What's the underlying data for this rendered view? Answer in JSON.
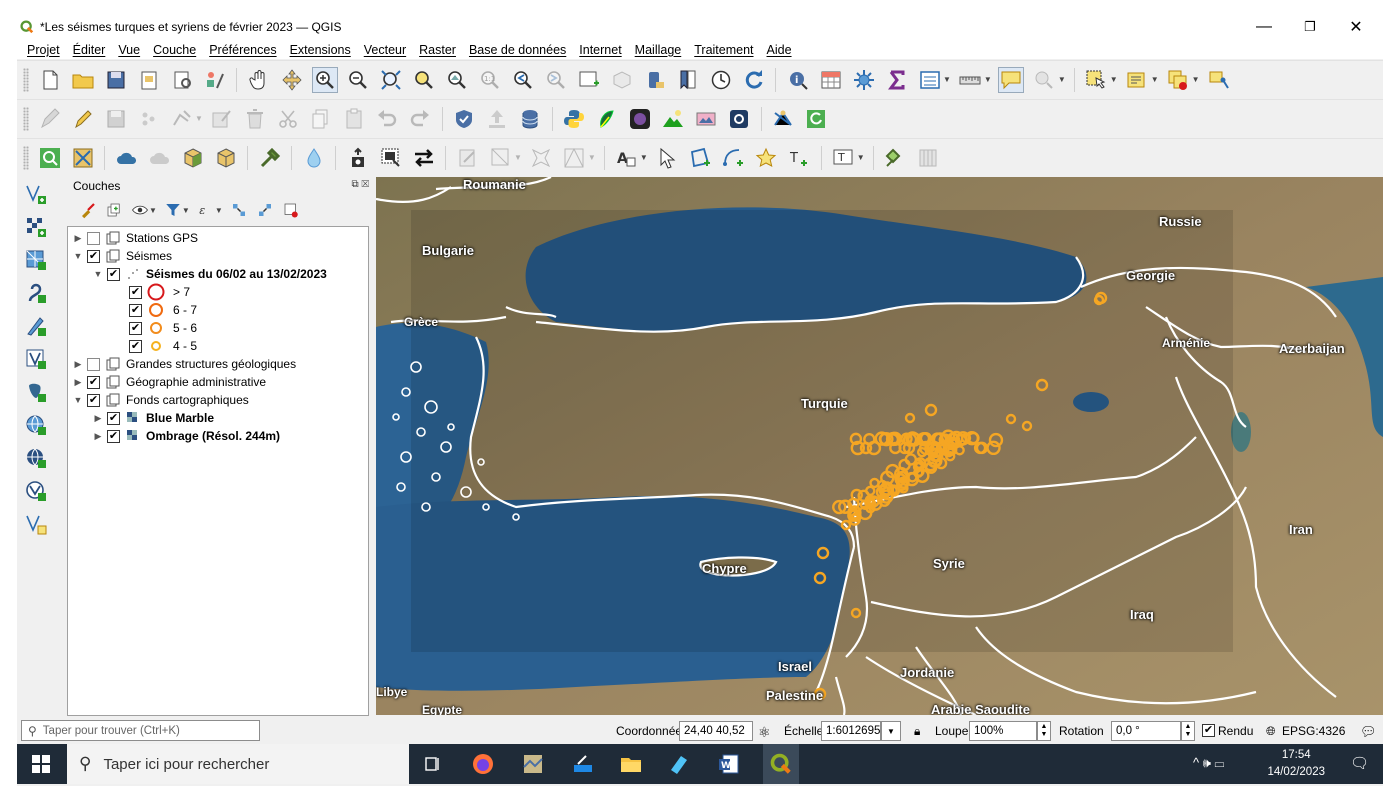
{
  "window": {
    "title": "*Les séismes turques et syriens de février 2023 — QGIS",
    "controls": {
      "minimize": "—",
      "restore": "❐",
      "close": "✕"
    }
  },
  "menu": [
    "Projet",
    "Éditer",
    "Vue",
    "Couche",
    "Préférences",
    "Extensions",
    "Vecteur",
    "Raster",
    "Base de données",
    "Internet",
    "Maillage",
    "Traitement",
    "Aide"
  ],
  "layers_panel": {
    "title": "Couches",
    "tree": [
      {
        "label": "Stations GPS",
        "checked": false,
        "expanded": false,
        "level": 0,
        "bold": false
      },
      {
        "label": "Séismes",
        "checked": true,
        "expanded": true,
        "level": 0,
        "bold": false
      },
      {
        "label": "Séismes du 06/02 au 13/02/2023",
        "checked": true,
        "expanded": true,
        "level": 1,
        "bold": true
      },
      {
        "label": "> 7",
        "checked": true,
        "level": 2,
        "legend_color": "#d7191c"
      },
      {
        "label": "6 - 7",
        "checked": true,
        "level": 2,
        "legend_color": "#f06a10"
      },
      {
        "label": "5 - 6",
        "checked": true,
        "level": 2,
        "legend_color": "#f28c1c"
      },
      {
        "label": "4 - 5",
        "checked": true,
        "level": 2,
        "legend_color": "#f5b21f"
      },
      {
        "label": "Grandes structures géologiques",
        "checked": false,
        "expanded": false,
        "level": 0,
        "bold": false
      },
      {
        "label": "Géographie administrative",
        "checked": true,
        "expanded": false,
        "level": 0,
        "bold": false
      },
      {
        "label": "Fonds cartographiques",
        "checked": true,
        "expanded": true,
        "level": 0,
        "bold": false
      },
      {
        "label": "Blue Marble",
        "checked": true,
        "expanded": false,
        "level": 1,
        "bold": true
      },
      {
        "label": "Ombrage (Résol. 244m)",
        "checked": true,
        "expanded": false,
        "level": 1,
        "bold": true
      }
    ]
  },
  "map": {
    "labels": [
      "Roumanie",
      "Russie",
      "Bulgarie",
      "Georgie",
      "Grèce",
      "Arménie",
      "Azerbaijan",
      "Turquie",
      "Iran",
      "Chypre",
      "Syrie",
      "Iraq",
      "Israel",
      "Jordanie",
      "Libye",
      "Palestine",
      "Egypte",
      "Arabie Saoudite"
    ],
    "colors": {
      "sea": "#2b5f8e",
      "land": "#8d7b55",
      "borders": "#ffffff",
      "quake": "#f5a623"
    }
  },
  "status": {
    "search_placeholder": "Taper pour trouver (Ctrl+K)",
    "coord_label": "Coordonnée",
    "coord_value": "24,40 40,52",
    "scale_label": "Échelle",
    "scale_value": "1:6012695",
    "magnifier_label": "Loupe",
    "magnifier_value": "100%",
    "rotation_label": "Rotation",
    "rotation_value": "0,0 °",
    "render_label": "Rendu",
    "render_checked": true,
    "crs": "EPSG:4326"
  },
  "taskbar": {
    "search_placeholder": "Taper ici pour rechercher",
    "time": "17:54",
    "date": "14/02/2023"
  }
}
